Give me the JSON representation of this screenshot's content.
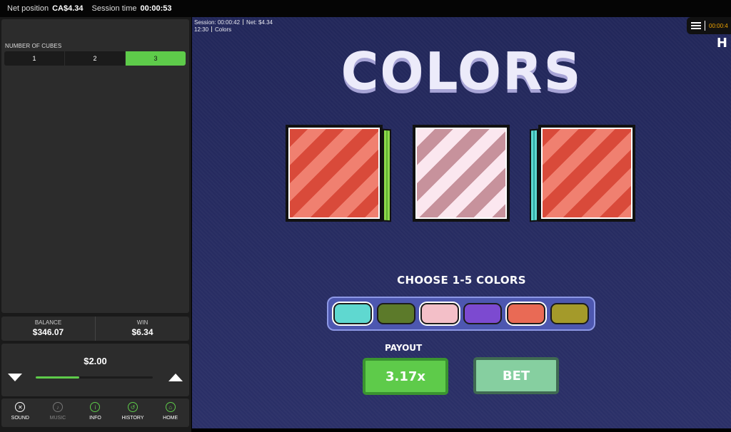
{
  "topbar": {
    "net_position_label": "Net position",
    "net_position_value": "CA$4.34",
    "session_time_label": "Session time",
    "session_time_value": "00:00:53"
  },
  "sidebar": {
    "cubes_label": "NUMBER OF CUBES",
    "cube_options": [
      "1",
      "2",
      "3"
    ],
    "selected_cubes": "3",
    "balance_label": "BALANCE",
    "balance_value": "$346.07",
    "win_label": "WIN",
    "win_value": "$6.34",
    "bet_amount": "$2.00",
    "bet_slider_level": 0.37,
    "nav": [
      {
        "label": "SOUND",
        "icon": "sound-off-icon"
      },
      {
        "label": "MUSIC",
        "icon": "music-off-icon"
      },
      {
        "label": "INFO",
        "icon": "info-icon"
      },
      {
        "label": "HISTORY",
        "icon": "history-icon"
      },
      {
        "label": "HOME",
        "icon": "home-icon"
      }
    ]
  },
  "game": {
    "session_line1_session": "Session: 00:00:42",
    "session_line1_net": "Net:  $4.34",
    "session_line2_time": "12:30",
    "session_line2_game": "Colors",
    "menu_time": "00:00:4",
    "title": "COLORS",
    "choose_label": "CHOOSE 1-5 COLORS",
    "swatches": [
      {
        "color": "#5fd8d0",
        "selected": true
      },
      {
        "color": "#5c7a2a",
        "selected": false
      },
      {
        "color": "#f3bfc8",
        "selected": true
      },
      {
        "color": "#7c4ad0",
        "selected": false
      },
      {
        "color": "#e96a55",
        "selected": true
      },
      {
        "color": "#a49a2a",
        "selected": false
      }
    ],
    "payout_label": "PAYOUT",
    "payout_value": "3.17x",
    "bet_button": "BET"
  }
}
